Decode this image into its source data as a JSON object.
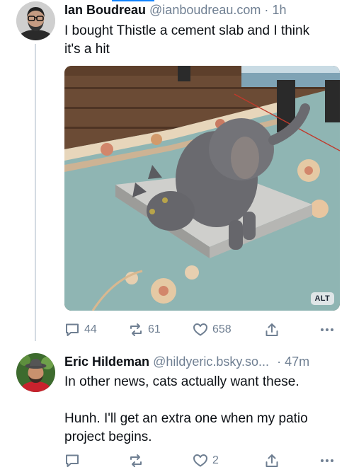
{
  "posts": [
    {
      "author_name": "Ian Boudreau",
      "handle": "@ianboudreau.com",
      "time": "1h",
      "text_lines": [
        "I bought Thistle a cement slab and I think",
        "it's a hit"
      ],
      "image_alt_badge": "ALT",
      "counts": {
        "replies": "44",
        "reposts": "61",
        "likes": "658"
      }
    },
    {
      "author_name": "Eric Hildeman",
      "handle": "@hildyeric.bsky.so...",
      "time": "47m",
      "text_lines": [
        "In other news, cats actually want these.",
        "",
        "Hunh. I'll get an extra one when my patio",
        "project begins."
      ],
      "counts": {
        "replies": "",
        "reposts": "",
        "likes": "2"
      }
    }
  ],
  "separator": "·",
  "colors": {
    "muted": "#6f7f92",
    "text": "#0b0f14",
    "accent": "#1083fe",
    "thread_line": "#d4dbe2"
  },
  "icons": [
    "reply-icon",
    "repost-icon",
    "like-icon",
    "share-icon",
    "more-icon"
  ]
}
